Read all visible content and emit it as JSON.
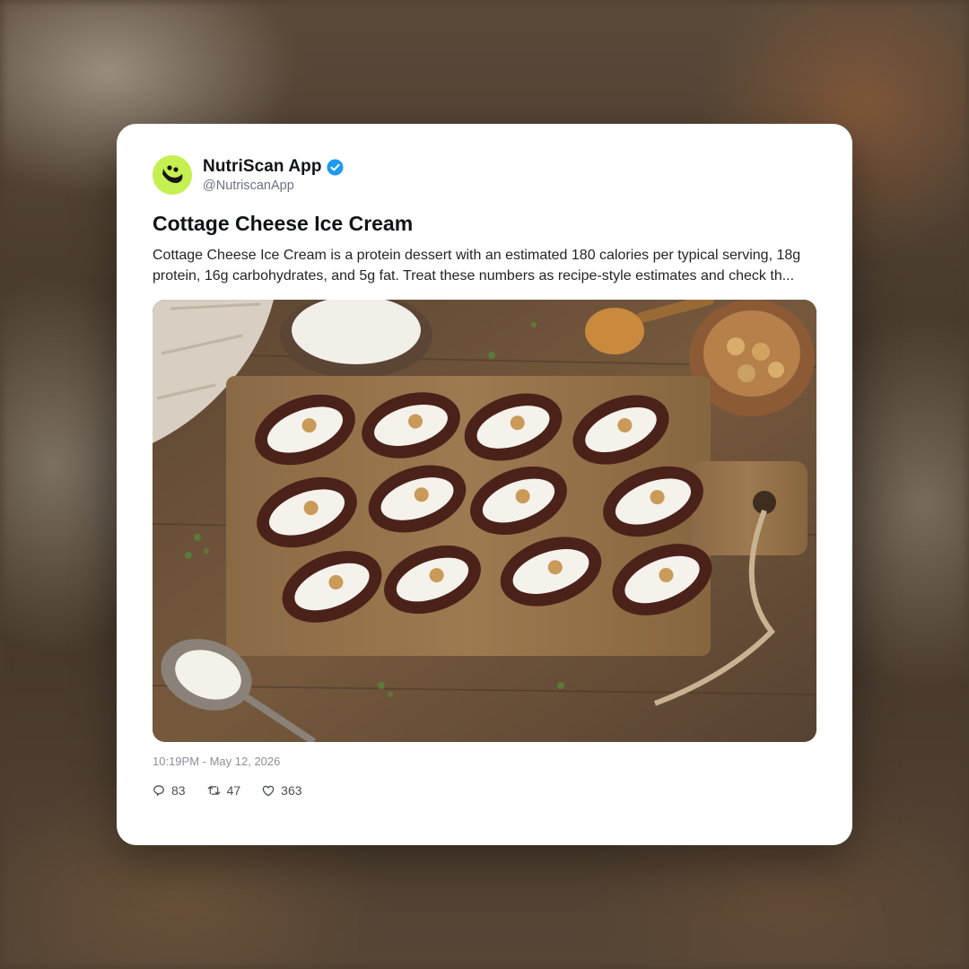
{
  "post": {
    "author": {
      "display_name": "NutriScan App",
      "handle": "@NutriscanApp",
      "verified": true,
      "avatar_color": "#c6ef52",
      "verified_color": "#1d9bf0"
    },
    "title": "Cottage Cheese Ice Cream",
    "body": "Cottage Cheese Ice Cream is a protein dessert with an estimated 180 calories per typical serving, 18g protein, 16g carbohydrates, and 5g fat. Treat these numbers as recipe-style estimates and check th...",
    "image_icon": "food-photo",
    "timestamp": "10:19PM - May 12, 2026",
    "stats": {
      "replies": "83",
      "retweets": "47",
      "likes": "363"
    }
  }
}
